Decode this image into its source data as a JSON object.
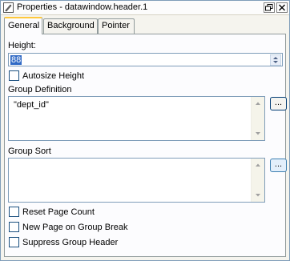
{
  "window": {
    "title": "Properties - datawindow.header.1"
  },
  "tabs": [
    {
      "label": "General"
    },
    {
      "label": "Background"
    },
    {
      "label": "Pointer"
    }
  ],
  "general": {
    "height_label": "Height:",
    "height_value": "88",
    "autosize_label": "Autosize Height",
    "autosize_checked": false,
    "group_def_label": "Group Definition",
    "group_def_value": "\"dept_id\"",
    "group_def_button": "...",
    "group_sort_label": "Group Sort",
    "group_sort_value": "",
    "group_sort_button": "...",
    "reset_page_label": "Reset Page Count",
    "reset_page_checked": false,
    "new_page_label": "New Page on Group Break",
    "new_page_checked": false,
    "suppress_header_label": "Suppress Group Header",
    "suppress_header_checked": false
  }
}
